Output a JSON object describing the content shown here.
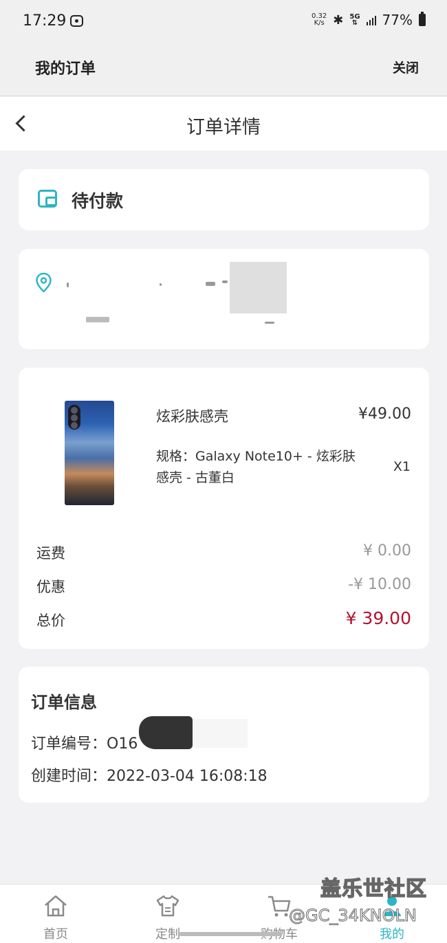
{
  "status_bar": {
    "time": "17:29",
    "net_speed_value": "0.32",
    "net_speed_unit": "K/s",
    "network": "5G",
    "battery": "77%"
  },
  "header": {
    "title": "我的订单",
    "close_label": "关闭"
  },
  "nav": {
    "title": "订单详情",
    "back_icon": "chevron-left-icon"
  },
  "order_status": {
    "icon": "wallet-icon",
    "label": "待付款",
    "accent_color": "#2cb5c3"
  },
  "address": {
    "icon": "location-pin-icon"
  },
  "product": {
    "name": "炫彩肤感壳",
    "price": "¥49.00",
    "spec": "规格：Galaxy Note10+ - 炫彩肤感壳 - 古董白",
    "quantity": "X1"
  },
  "fees": [
    {
      "label": "运费",
      "value": "¥ 0.00"
    },
    {
      "label": "优惠",
      "value": "-¥ 10.00"
    },
    {
      "label": "总价",
      "value": "¥ 39.00"
    }
  ],
  "total_color": "#b5112d",
  "order_info": {
    "title": "订单信息",
    "number_label": "订单编号：",
    "number_value": "O16",
    "created_label": "创建时间：",
    "created_value": "2022-03-04 16:08:18"
  },
  "tabs": [
    {
      "label": "首页",
      "icon": "home-icon"
    },
    {
      "label": "定制",
      "icon": "tshirt-icon"
    },
    {
      "label": "购物车",
      "icon": "cart-icon"
    },
    {
      "label": "我的",
      "icon": "user-icon",
      "active": true
    }
  ],
  "watermark": {
    "line1": "盖乐世社区",
    "line2": "@GC_34KNOLN"
  }
}
